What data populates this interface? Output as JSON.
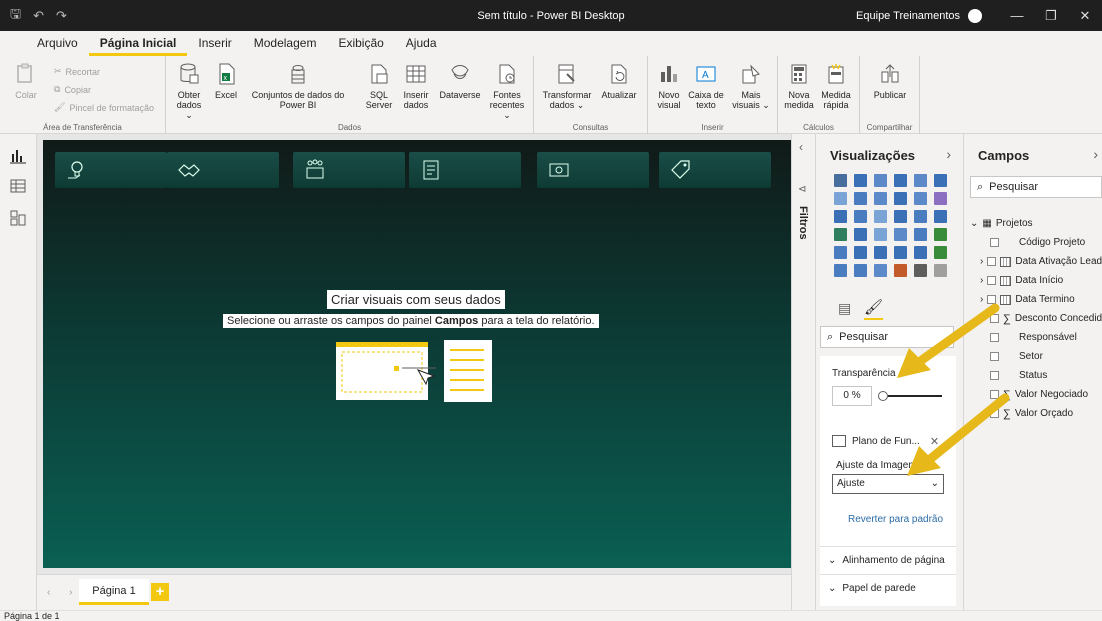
{
  "titlebar": {
    "title": "Sem título - Power BI Desktop",
    "user": "Equipe Treinamentos",
    "controls": [
      "—",
      "❐",
      "✕"
    ]
  },
  "menu": {
    "tabs": [
      "Arquivo",
      "Página Inicial",
      "Inserir",
      "Modelagem",
      "Exibição",
      "Ajuda"
    ],
    "active": "Página Inicial"
  },
  "ribbon": {
    "clipboard": {
      "paste": "Colar",
      "cut": "Recortar",
      "copy": "Copiar",
      "format_painter": "Pincel de formatação",
      "label": "Área de Transferência"
    },
    "data": {
      "label": "Dados",
      "buttons": [
        "Obter dados ⌄",
        "Excel",
        "Conjuntos de dados do Power BI",
        "SQL Server",
        "Inserir dados",
        "Dataverse",
        "Fontes recentes ⌄"
      ]
    },
    "queries": {
      "label": "Consultas",
      "buttons": [
        "Transformar dados ⌄",
        "Atualizar"
      ]
    },
    "insert": {
      "label": "Inserir",
      "buttons": [
        "Novo visual",
        "Caixa de texto",
        "Mais visuais ⌄"
      ]
    },
    "calcs": {
      "label": "Cálculos",
      "buttons": [
        "Nova medida",
        "Medida rápida"
      ]
    },
    "share": {
      "label": "Compartilhar",
      "buttons": [
        "Publicar"
      ]
    }
  },
  "canvas": {
    "empty_title": "Criar visuais com seus dados",
    "empty_sub_pre": "Selecione ou arraste os campos do painel ",
    "empty_sub_bold": "Campos",
    "empty_sub_post": " para a tela do relatório."
  },
  "pages": {
    "tab": "Página 1",
    "add": "+",
    "status": "Página 1 de 1"
  },
  "filters": {
    "label": "Filtros"
  },
  "visualizations": {
    "title": "Visualizações",
    "search_placeholder": "Pesquisar",
    "transparency_label": "Transparência",
    "transparency_value": "0",
    "transparency_unit": "%",
    "image_label": "Plano de Fun...",
    "fit_label": "Ajuste da Imagem",
    "fit_value": "Ajuste",
    "revert": "Reverter para padrão",
    "accordion": [
      "Alinhamento de página",
      "Papel de parede"
    ]
  },
  "fields": {
    "title": "Campos",
    "search_placeholder": "Pesquisar",
    "table": "Projetos",
    "items": [
      {
        "name": "Código Projeto",
        "type": "text"
      },
      {
        "name": "Data Ativação Lead",
        "type": "date"
      },
      {
        "name": "Data Início",
        "type": "date"
      },
      {
        "name": "Data Termino",
        "type": "date"
      },
      {
        "name": "Desconto Concedido",
        "type": "sum"
      },
      {
        "name": "Responsável",
        "type": "text"
      },
      {
        "name": "Setor",
        "type": "text"
      },
      {
        "name": "Status",
        "type": "text"
      },
      {
        "name": "Valor Negociado",
        "type": "sum"
      },
      {
        "name": "Valor Orçado",
        "type": "sum"
      }
    ]
  },
  "colors": {
    "accent": "#f2c811",
    "canvas_top": "#101a18",
    "canvas_bottom": "#0a5f53",
    "arrow": "#e6b819"
  }
}
